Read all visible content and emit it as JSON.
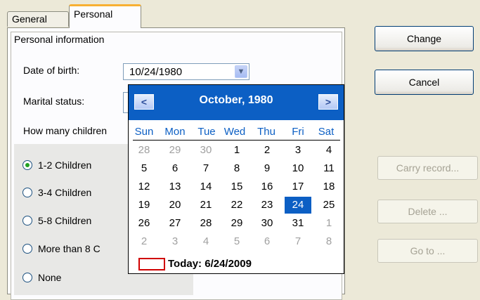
{
  "tabs": {
    "general": "General",
    "personal": "Personal"
  },
  "group": {
    "title": "Personal information"
  },
  "fields": {
    "dob_label": "Date of birth:",
    "dob_value": "10/24/1980",
    "marital_label": "Marital status:",
    "children_label": "How many children"
  },
  "radios": [
    {
      "label": "1-2 Children",
      "checked": true
    },
    {
      "label": "3-4 Children",
      "checked": false
    },
    {
      "label": "5-8 Children",
      "checked": false
    },
    {
      "label": "More than 8 C",
      "checked": false
    },
    {
      "label": "None",
      "checked": false
    }
  ],
  "buttons": {
    "change": "Change",
    "cancel": "Cancel",
    "carry": "Carry record...",
    "delete": "Delete ...",
    "goto": "Go to ..."
  },
  "calendar": {
    "title": "October, 1980",
    "prev": "<",
    "next": ">",
    "dow": [
      "Sun",
      "Mon",
      "Tue",
      "Wed",
      "Thu",
      "Fri",
      "Sat"
    ],
    "weeks": [
      [
        "28",
        "29",
        "30",
        "1",
        "2",
        "3",
        "4"
      ],
      [
        "5",
        "6",
        "7",
        "8",
        "9",
        "10",
        "11"
      ],
      [
        "12",
        "13",
        "14",
        "15",
        "16",
        "17",
        "18"
      ],
      [
        "19",
        "20",
        "21",
        "22",
        "23",
        "24",
        "25"
      ],
      [
        "26",
        "27",
        "28",
        "29",
        "30",
        "31",
        "1"
      ],
      [
        "2",
        "3",
        "4",
        "5",
        "6",
        "7",
        "8"
      ]
    ],
    "other_month": [
      [
        true,
        true,
        true,
        false,
        false,
        false,
        false
      ],
      [
        false,
        false,
        false,
        false,
        false,
        false,
        false
      ],
      [
        false,
        false,
        false,
        false,
        false,
        false,
        false
      ],
      [
        false,
        false,
        false,
        false,
        false,
        false,
        false
      ],
      [
        false,
        false,
        false,
        false,
        false,
        false,
        true
      ],
      [
        true,
        true,
        true,
        true,
        true,
        true,
        true
      ]
    ],
    "selected": "24",
    "today": "Today: 6/24/2009"
  }
}
